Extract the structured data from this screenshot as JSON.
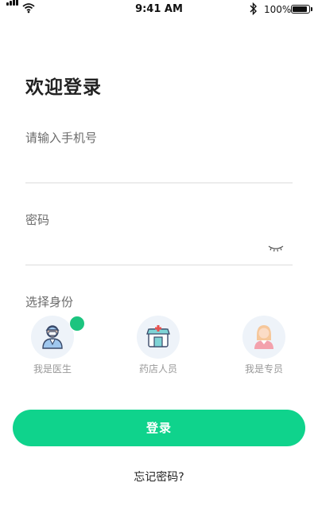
{
  "status_bar": {
    "time": "9:41 AM",
    "battery_pct": "100%",
    "battery_level": 1.0,
    "icons": [
      "signal-icon",
      "wifi-icon",
      "bluetooth-icon",
      "battery-icon"
    ]
  },
  "login": {
    "title": "欢迎登录",
    "phone_label": "请输入手机号",
    "phone_value": "",
    "password_label": "密码",
    "password_value": "",
    "role_label": "选择身份",
    "roles": [
      {
        "label": "我是医生",
        "icon": "doctor-icon",
        "selected": true
      },
      {
        "label": "药店人员",
        "icon": "pharmacy-icon",
        "selected": false
      },
      {
        "label": "我是专员",
        "icon": "specialist-icon",
        "selected": false
      }
    ],
    "submit_label": "登录",
    "forgot_label": "忘记密码?"
  },
  "colors": {
    "accent": "#0fd38c",
    "check": "#1cc47f",
    "role_bg": "#eef3f9"
  }
}
